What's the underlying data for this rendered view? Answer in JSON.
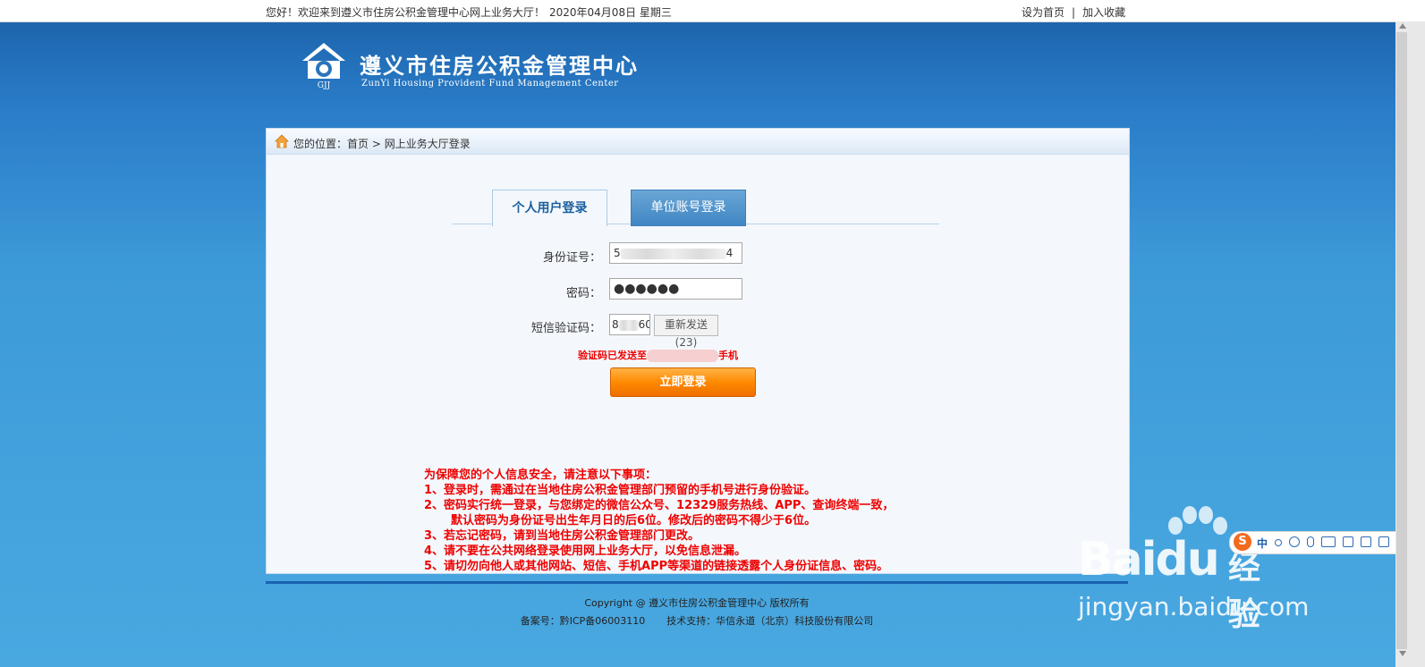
{
  "topbar": {
    "welcome": "您好！欢迎来到遵义市住房公积金管理中心网上业务大厅！",
    "date": "2020年04月08日 星期三",
    "set_home": "设为首页",
    "separator": "|",
    "bookmark": "加入收藏"
  },
  "header": {
    "logo_abbr": "GJJ",
    "title": "遵义市住房公积金管理中心",
    "subtitle": "ZunYi Housing Provident Fund Management Center"
  },
  "breadcrumb": {
    "prefix": "您的位置：",
    "home": "首页",
    "arrow": ">",
    "current": "网上业务大厅登录"
  },
  "tabs": [
    {
      "label": "个人用户登录",
      "active": true
    },
    {
      "label": "单位账号登录",
      "active": false
    }
  ],
  "form": {
    "id_label": "身份证号：",
    "id_value_start": "5",
    "id_value_end": "4",
    "password_label": "密码：",
    "password_value": "●●●●●●",
    "sms_label": "短信验证码：",
    "sms_value_start": "8",
    "sms_value_end": "60",
    "resend_label": "重新发送(23)",
    "sent_prefix": "验证码已发送至",
    "sent_suffix": "手机",
    "login_button": "立即登录"
  },
  "notice": {
    "title": "为保障您的个人信息安全，请注意以下事项：",
    "items": [
      "1、登录时，需通过在当地住房公积金管理部门预留的手机号进行身份验证。",
      "2、密码实行统一登录，与您绑定的微信公众号、12329服务热线、APP、查询终端一致，",
      "默认密码为身份证号出生年月日的后6位。修改后的密码不得少于6位。",
      "3、若忘记密码，请到当地住房公积金管理部门更改。",
      "4、请不要在公共网络登录使用网上业务大厅，以免信息泄漏。",
      "5、请切勿向他人或其他网站、短信、手机APP等渠道的链接透露个人身份证信息、密码。"
    ]
  },
  "footer": {
    "copyright": "Copyright @ 遵义市住房公积金管理中心 版权所有",
    "icp": "备案号：黔ICP备06003110",
    "support": "技术支持：华信永道（北京）科技股份有限公司"
  },
  "ime_bar": {
    "logo": "S",
    "mode": "中",
    "icons": [
      "punctuation-icon",
      "emoji-icon",
      "microphone-icon",
      "keyboard-icon",
      "user-icon",
      "skin-icon",
      "toolbox-icon"
    ]
  },
  "watermark": {
    "brand": "Baidu",
    "cn": "经验",
    "url": "jingyan.baidu.com"
  },
  "colors": {
    "bg_top": "#1a5fa6",
    "bg_bottom": "#49a8e0",
    "notice_red": "#ee0000",
    "login_orange": "#ff8a00",
    "tab_blue": "#3f86c3"
  }
}
